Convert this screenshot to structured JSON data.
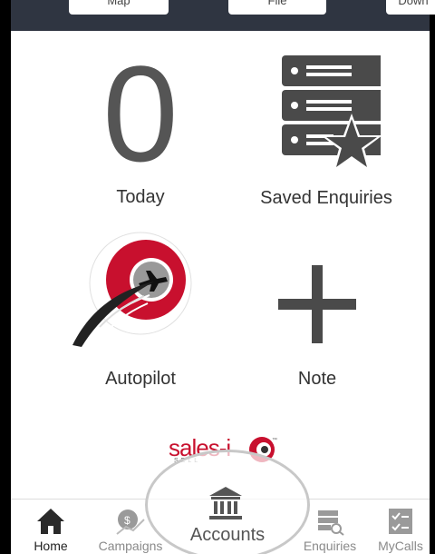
{
  "header": {
    "btn_left": "Map",
    "btn_mid": "File",
    "btn_right": "Down"
  },
  "tiles": {
    "today": {
      "value": "0",
      "label": "Today"
    },
    "saved": {
      "label": "Saved Enquiries"
    },
    "autopilot": {
      "label": "Autopilot"
    },
    "note": {
      "label": "Note"
    }
  },
  "logo": {
    "text": "sales-i",
    "tagline": "SELL"
  },
  "tabs": [
    {
      "label": "Home",
      "active": true
    },
    {
      "label": "Campaigns",
      "active": false
    },
    {
      "label": "Accounts",
      "active": false
    },
    {
      "label": "Enquiries",
      "active": false
    },
    {
      "label": "MyCalls",
      "active": false
    }
  ],
  "colors": {
    "header_bg": "#2f3541",
    "icon_gray": "#4a4a4a",
    "brand_red": "#c8102e"
  }
}
